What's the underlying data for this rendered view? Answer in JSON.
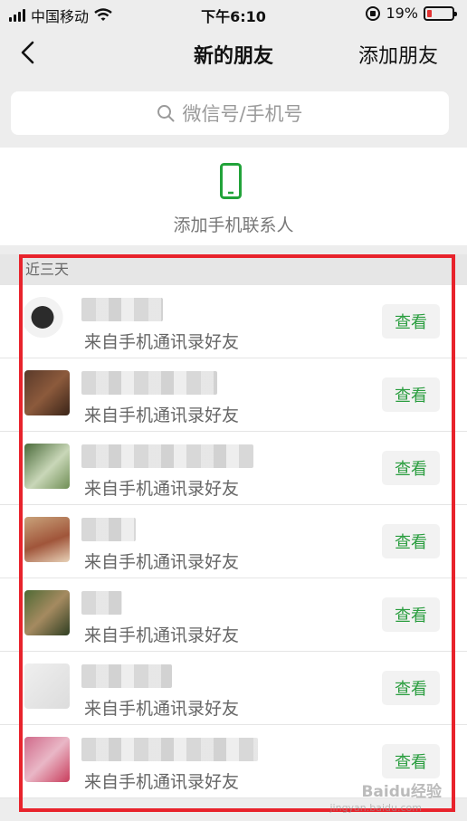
{
  "status_bar": {
    "carrier": "中国移动",
    "time": "下午6:10",
    "battery_percent": "19%",
    "battery_level": 0.19,
    "battery_color": "#e33333"
  },
  "nav": {
    "back_icon": "chevron-left-icon",
    "title": "新的朋友",
    "action": "添加朋友"
  },
  "search": {
    "placeholder": "微信号/手机号"
  },
  "phone_contacts": {
    "icon": "mobile-phone-icon",
    "label": "添加手机联系人",
    "icon_color": "#22a33a"
  },
  "section": {
    "title": "近三天"
  },
  "friends": [
    {
      "source": "来自手机通讯录好友",
      "button": "查看"
    },
    {
      "source": "来自手机通讯录好友",
      "button": "查看"
    },
    {
      "source": "来自手机通讯录好友",
      "button": "查看"
    },
    {
      "source": "来自手机通讯录好友",
      "button": "查看"
    },
    {
      "source": "来自手机通讯录好友",
      "button": "查看"
    },
    {
      "source": "来自手机通讯录好友",
      "button": "查看"
    },
    {
      "source": "来自手机通讯录好友",
      "button": "查看"
    }
  ],
  "colors": {
    "accent_green": "#2a9d3f",
    "highlight_red": "#e8232c"
  },
  "watermark": {
    "text": "Baidu经验",
    "sub": "jingyan.baidu.com"
  }
}
